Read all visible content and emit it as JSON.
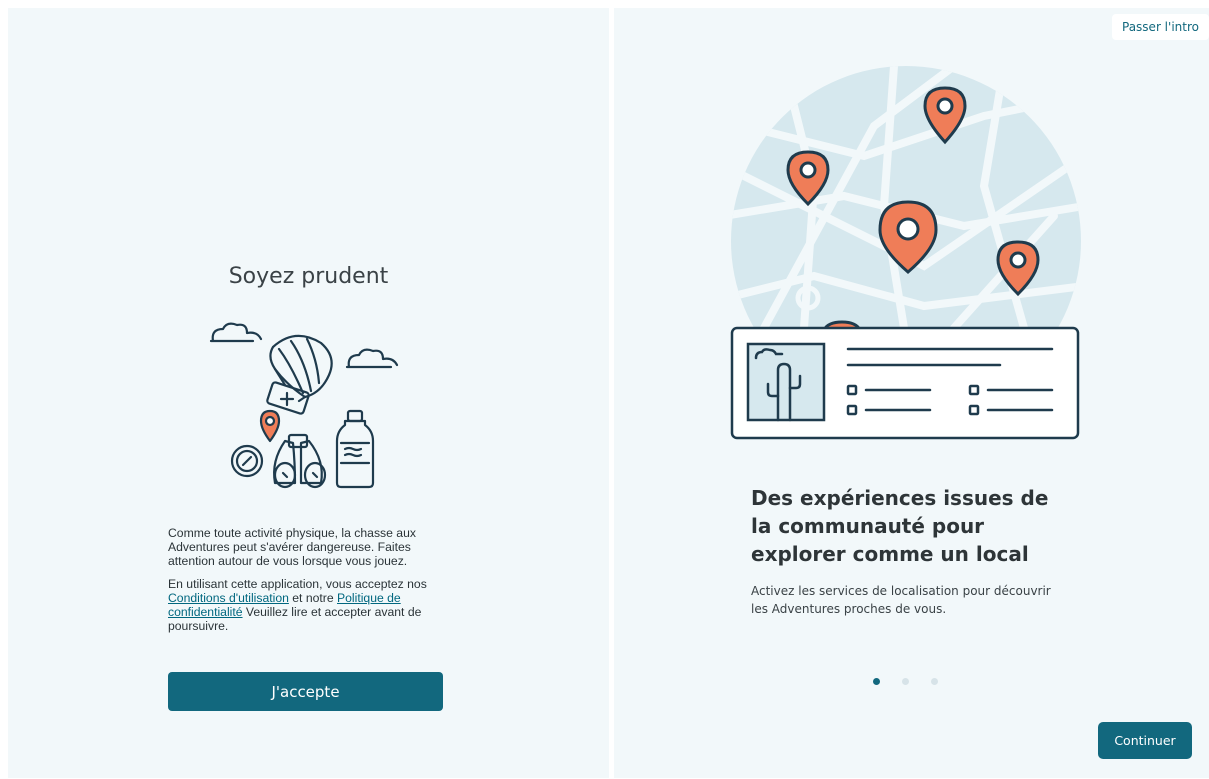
{
  "intro_panel": {
    "title": "Soyez prudent",
    "paragraph1": "Comme toute activité physique, la chasse aux Adventures peut s'avérer dangereuse. Faites attention autour de vous lorsque vous jouez.",
    "paragraph2_prefix": "En utilisant cette application, vous acceptez nos ",
    "terms_link": "Conditions d'utilisation",
    "paragraph2_middle": " et notre ",
    "privacy_link": "Politique de confidentialité",
    "paragraph2_suffix": " Veuillez lire et accepter avant de poursuivre.",
    "accept_label": "J'accepte",
    "illustration_icons": [
      "cloud-icon",
      "parachute-crate-icon",
      "location-pin-icon",
      "compass-icon",
      "binoculars-icon",
      "water-bottle-icon"
    ]
  },
  "onboarding_panel": {
    "skip_label": "Passer l'intro",
    "headline": "Des expériences issues de la communauté pour explorer comme un local",
    "description": "Activez les services de localisation pour découvrir les Adventures proches de vous.",
    "continue_label": "Continuer",
    "page_indicator": {
      "pages": 3,
      "active": 1
    },
    "illustration_icons": [
      "map-icon",
      "map-pin-icon",
      "adventure-card-icon",
      "cactus-icon"
    ]
  },
  "colors": {
    "accent": "#12687e",
    "panel_background": "#f2f8fa",
    "pin_orange": "#ef7d58",
    "map_blue": "#d6e8ee",
    "outline": "#1f3b4d"
  }
}
